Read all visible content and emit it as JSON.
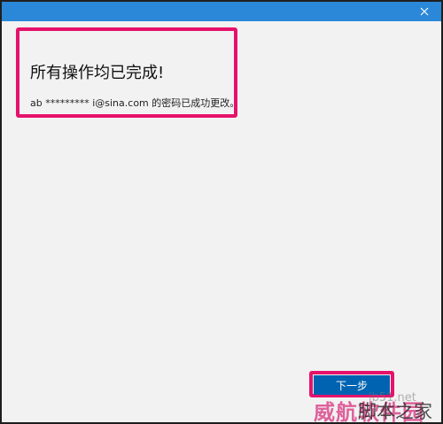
{
  "dialog": {
    "heading": "所有操作均已完成!",
    "message": "ab ********* i@sina.com 的密码已成功更改。",
    "primary_button": "下一步"
  },
  "watermark": {
    "url": "jb51.net",
    "text_a": "威航软件园",
    "text_b": "脚本之家"
  },
  "colors": {
    "titlebar": "#2b88d8",
    "highlight": "#e6126b",
    "button": "#0063b1",
    "background": "#f2f2f2"
  }
}
